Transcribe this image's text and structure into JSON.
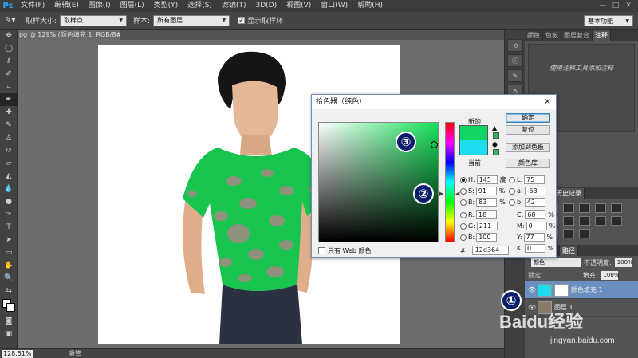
{
  "app": {
    "logo": "Ps",
    "menu": [
      "文件(F)",
      "编辑(E)",
      "图像(I)",
      "图层(L)",
      "类型(Y)",
      "选择(S)",
      "滤镜(T)",
      "3D(D)",
      "视图(V)",
      "窗口(W)",
      "帮助(H)"
    ],
    "window_controls": [
      "—",
      "□",
      "✕"
    ]
  },
  "options_bar": {
    "sample_size_label": "取样大小:",
    "sample_size_value": "取样点",
    "sample_label": "样本:",
    "sample_value": "所有图层",
    "show_ring_label": "显示取样环",
    "workspace": "基本功能"
  },
  "document": {
    "tab_title": "pg @ 129% (颜色填充 1, RGB/8#) *",
    "close": "×"
  },
  "status_bar": {
    "zoom": "128.51%",
    "info": "吸管"
  },
  "right_panels": {
    "top_tabs": [
      "颜色",
      "色板",
      "图层复合",
      "注释"
    ],
    "active_top_tab": "注释",
    "note_text": "使用注释工具添加注释",
    "mid_tabs": [
      "历史记录"
    ],
    "layer_tabs": [
      "路径"
    ],
    "blend_mode": "颜色",
    "opacity_label": "不透明度:",
    "opacity_value": "100%",
    "lock_label": "锁定:",
    "fill_label": "填充:",
    "fill_value": "100%",
    "layers": [
      {
        "name": "颜色填充 1",
        "active": true
      },
      {
        "name": "图层 1",
        "active": false
      }
    ]
  },
  "color_picker": {
    "title": "拾色器（纯色）",
    "close": "✕",
    "new_label": "新的",
    "current_label": "当前",
    "new_color": "#12d364",
    "current_color": "#1edcf0",
    "buttons": {
      "ok": "确定",
      "reset": "复位",
      "add_swatch": "添加到色板",
      "color_libraries": "颜色库"
    },
    "hsb": {
      "h_label": "H:",
      "h_value": "145",
      "h_unit": "度",
      "s_label": "S:",
      "s_value": "91",
      "s_unit": "%",
      "b_label": "B:",
      "b_value": "83",
      "b_unit": "%"
    },
    "rgb": {
      "r_label": "R:",
      "r_value": "18",
      "g_label": "G:",
      "g_value": "211",
      "b_label": "B:",
      "b_value": "100"
    },
    "lab": {
      "l_label": "L:",
      "l_value": "75",
      "a_label": "a:",
      "a_value": "-63",
      "b_label": "b:",
      "b_value": "42"
    },
    "cmyk": {
      "c_label": "C:",
      "c_value": "68",
      "c_unit": "%",
      "m_label": "M:",
      "m_value": "0",
      "m_unit": "%",
      "y_label": "Y:",
      "y_value": "77",
      "y_unit": "%",
      "k_label": "K:",
      "k_value": "0",
      "k_unit": "%"
    },
    "hex_label": "#",
    "hex_value": "12d364",
    "web_only_label": "只有 Web 颜色"
  },
  "annotations": [
    "①",
    "②",
    "③"
  ],
  "watermark": {
    "main": "Baidu经验",
    "sub": "jingyan.baidu.com"
  }
}
